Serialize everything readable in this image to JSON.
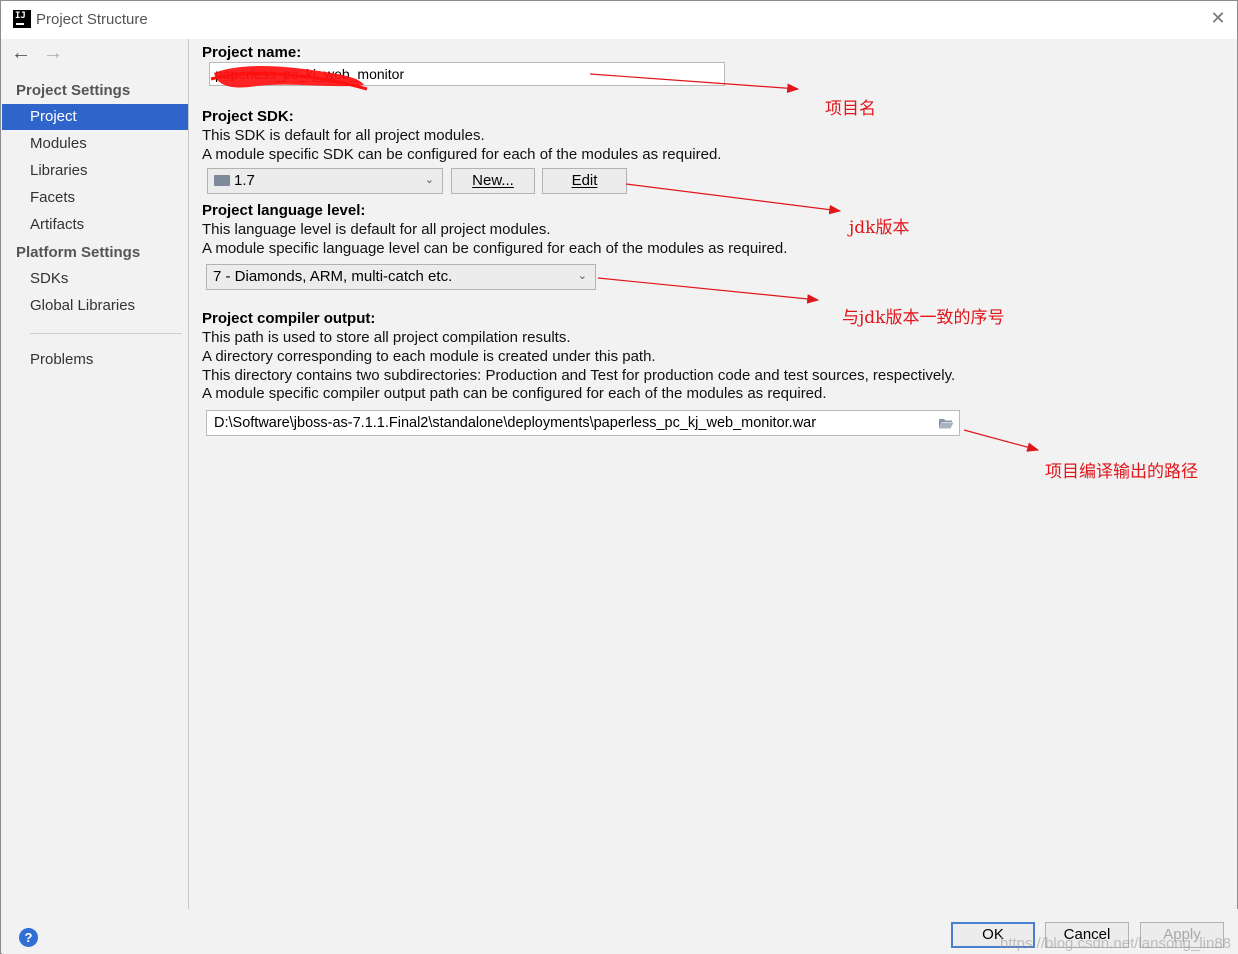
{
  "window": {
    "title": "Project Structure",
    "close_glyph": "✕",
    "logo_text": "IJ"
  },
  "nav": {
    "back_glyph": "←",
    "forward_glyph": "→"
  },
  "sidebar": {
    "project_settings_header": "Project Settings",
    "project_settings_items": [
      {
        "label": "Project",
        "selected": true
      },
      {
        "label": "Modules"
      },
      {
        "label": "Libraries"
      },
      {
        "label": "Facets"
      },
      {
        "label": "Artifacts"
      }
    ],
    "platform_settings_header": "Platform Settings",
    "platform_settings_items": [
      {
        "label": "SDKs"
      },
      {
        "label": "Global Libraries"
      }
    ],
    "problems_label": "Problems"
  },
  "project_name": {
    "label": "Project name:",
    "value": "paperless_pc_kj_web_monitor"
  },
  "project_sdk": {
    "label": "Project SDK:",
    "desc1": "This SDK is default for all project modules.",
    "desc2": "A module specific SDK can be configured for each of the modules as required.",
    "selected": "1.7",
    "new_button": "New...",
    "edit_button": "Edit"
  },
  "language_level": {
    "label": "Project language level:",
    "desc1": "This language level is default for all project modules.",
    "desc2": "A module specific language level can be configured for each of the modules as required.",
    "selected": "7 - Diamonds, ARM, multi-catch etc."
  },
  "compiler_output": {
    "label": "Project compiler output:",
    "desc1": "This path is used to store all project compilation results.",
    "desc2": "A directory corresponding to each module is created under this path.",
    "desc3": "This directory contains two subdirectories: Production and Test for production code and test sources, respectively.",
    "desc4": "A module specific compiler output path can be configured for each of the modules as required.",
    "path": "D:\\Software\\jboss-as-7.1.1.Final2\\standalone\\deployments\\paperless_pc_kj_web_monitor.war"
  },
  "footer": {
    "help_glyph": "?",
    "ok": "OK",
    "cancel": "Cancel",
    "apply": "Apply",
    "watermark": "https://blog.csdn.net/lansong_lin88"
  },
  "annotations": {
    "color": "#e0161b",
    "project_name_note": "项目名",
    "jdk_note": "jdk版本",
    "language_note": "与jdk版本一致的序号",
    "output_note": "项目编译输出的路径"
  },
  "colors": {
    "selection": "#2f65ca",
    "background": "#f2f2f2",
    "help_button": "#2f6fd6"
  }
}
